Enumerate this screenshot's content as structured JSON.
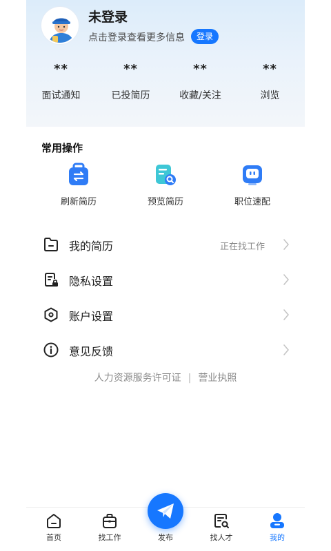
{
  "profile": {
    "name": "未登录",
    "subtitle": "点击登录查看更多信息",
    "login_button": "登录"
  },
  "stats": [
    {
      "value": "**",
      "label": "面试通知"
    },
    {
      "value": "**",
      "label": "已投简历"
    },
    {
      "value": "**",
      "label": "收藏/关注"
    },
    {
      "value": "**",
      "label": "浏览"
    }
  ],
  "common_ops": {
    "title": "常用操作",
    "items": [
      {
        "label": "刷新简历",
        "icon": "refresh-resume-icon"
      },
      {
        "label": "预览简历",
        "icon": "preview-resume-icon"
      },
      {
        "label": "职位速配",
        "icon": "job-match-icon"
      }
    ]
  },
  "menu": [
    {
      "label": "我的简历",
      "value": "正在找工作",
      "icon": "resume-folder-icon"
    },
    {
      "label": "隐私设置",
      "value": "",
      "icon": "privacy-lock-icon"
    },
    {
      "label": "账户设置",
      "value": "",
      "icon": "account-settings-icon"
    },
    {
      "label": "意见反馈",
      "value": "",
      "icon": "info-icon"
    }
  ],
  "license": {
    "left": "人力资源服务许可证",
    "separator": "|",
    "right": "营业执照"
  },
  "tabbar": [
    {
      "label": "首页",
      "icon": "home-icon"
    },
    {
      "label": "找工作",
      "icon": "briefcase-icon"
    },
    {
      "label": "发布",
      "icon": "send-icon"
    },
    {
      "label": "找人才",
      "icon": "talent-search-icon"
    },
    {
      "label": "我的",
      "icon": "profile-icon"
    }
  ],
  "colors": {
    "accent": "#1677ff",
    "header_gradient_top": "#dcecfa",
    "muted_text": "#8a8a8a"
  }
}
